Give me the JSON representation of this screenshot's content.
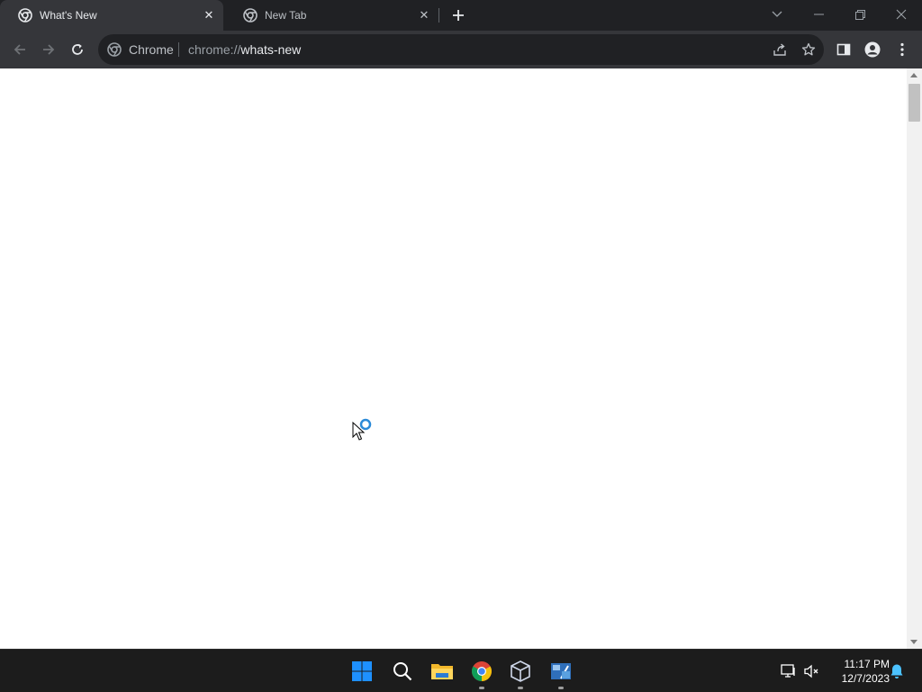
{
  "tabs": [
    {
      "title": "What's New",
      "active": true
    },
    {
      "title": "New Tab",
      "active": false
    }
  ],
  "omnibox": {
    "chip_label": "Chrome",
    "url_scheme": "chrome://",
    "url_host": "whats-new"
  },
  "taskbar": {
    "apps": [
      "start-icon",
      "search-icon",
      "file-explorer-icon",
      "chrome-icon",
      "virtualbox-icon",
      "xp-mode-icon"
    ],
    "time": "11:17 PM",
    "date": "12/7/2023"
  },
  "colors": {
    "tabstrip_bg": "#202124",
    "toolbar_bg": "#35363a",
    "omnibox_bg": "#202124",
    "content_bg": "#ffffff",
    "taskbar_bg": "#1c1c1c",
    "accent_blue": "#0078d4"
  }
}
